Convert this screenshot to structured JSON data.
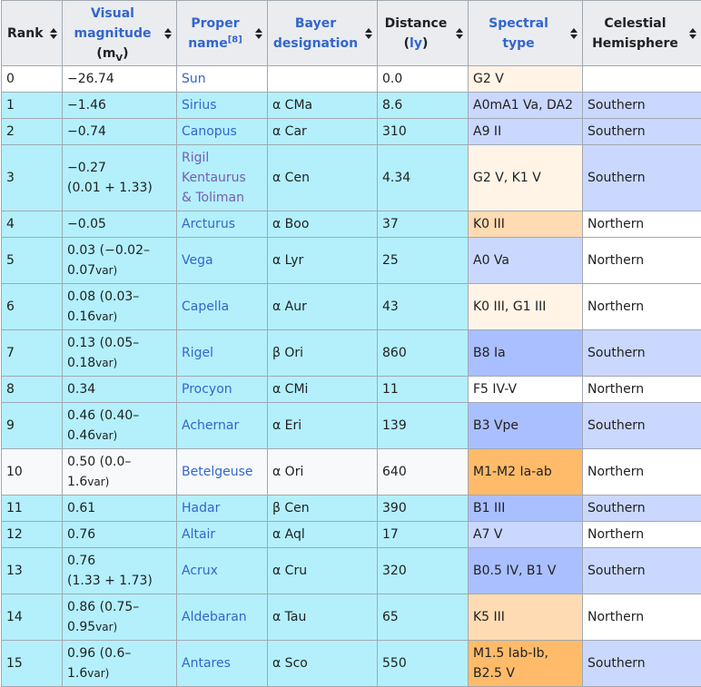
{
  "headers": {
    "rank": "Rank",
    "vmag_line1": "Visual",
    "vmag_line2": "magnitude",
    "vmag_unit_pre": "(m",
    "vmag_unit_sub": "V",
    "vmag_unit_post": ")",
    "proper_line1": "Proper",
    "proper_line2": "name",
    "proper_ref": "[8]",
    "bayer_line1": "Bayer",
    "bayer_line2": "designation",
    "distance_line1": "Distance",
    "distance_line2_pre": "(",
    "distance_unit": "ly",
    "distance_line2_post": ")",
    "spectral_line1": "Spectral",
    "spectral_line2": "type",
    "hemi_line1": "Celestial",
    "hemi_line2": "Hemisphere"
  },
  "rows": [
    {
      "rank": "0",
      "mag1": "−26.74",
      "mag2": "",
      "mag_var": "",
      "name": [
        "Sun"
      ],
      "bayer": "",
      "dist": "0.0",
      "spec": [
        "G2 V"
      ],
      "hemi": "",
      "spec_color": "#fff4e6",
      "hemi_color": "#ffffff",
      "row_color": "#ffffff",
      "name_visited": false
    },
    {
      "rank": "1",
      "mag1": "−1.46",
      "mag2": "",
      "mag_var": "",
      "name": [
        "Sirius"
      ],
      "bayer": "α CMa",
      "dist": "8.6",
      "spec": [
        "A0mA1 Va, DA2"
      ],
      "hemi": "Southern",
      "spec_color": "#cad8ff",
      "hemi_color": "#cad8ff",
      "row_color": "#b3f0fc",
      "name_visited": false
    },
    {
      "rank": "2",
      "mag1": "−0.74",
      "mag2": "",
      "mag_var": "",
      "name": [
        "Canopus"
      ],
      "bayer": "α Car",
      "dist": "310",
      "spec": [
        "A9 II"
      ],
      "hemi": "Southern",
      "spec_color": "#cad8ff",
      "hemi_color": "#cad8ff",
      "row_color": "#b3f0fc",
      "name_visited": false
    },
    {
      "rank": "3",
      "mag1": "−0.27",
      "mag2": "(0.01 + 1.33)",
      "mag_var": "",
      "name": [
        "Rigil",
        "Kentaurus",
        "& Toliman"
      ],
      "bayer": "α Cen",
      "dist": "4.34",
      "spec": [
        "G2 V, K1 V"
      ],
      "hemi": "Southern",
      "spec_color": "#fff4e6",
      "hemi_color": "#cad8ff",
      "row_color": "#b3f0fc",
      "name_visited": true
    },
    {
      "rank": "4",
      "mag1": "−0.05",
      "mag2": "",
      "mag_var": "",
      "name": [
        "Arcturus"
      ],
      "bayer": "α Boo",
      "dist": "37",
      "spec": [
        "K0 III"
      ],
      "hemi": "Northern",
      "spec_color": "#ffdbb3",
      "hemi_color": "#ffffff",
      "row_color": "#b3f0fc",
      "name_visited": false
    },
    {
      "rank": "5",
      "mag1": "0.03 (−0.02–",
      "mag2": "0.07",
      "mag_var": "var)",
      "name": [
        "Vega"
      ],
      "bayer": "α Lyr",
      "dist": "25",
      "spec": [
        "A0 Va"
      ],
      "hemi": "Northern",
      "spec_color": "#cad8ff",
      "hemi_color": "#ffffff",
      "row_color": "#b3f0fc",
      "name_visited": false
    },
    {
      "rank": "6",
      "mag1": "0.08 (0.03–",
      "mag2": "0.16",
      "mag_var": "var)",
      "name": [
        "Capella"
      ],
      "bayer": "α Aur",
      "dist": "43",
      "spec": [
        "K0 III, G1 III"
      ],
      "hemi": "Northern",
      "spec_color": "#fff4e6",
      "hemi_color": "#ffffff",
      "row_color": "#b3f0fc",
      "name_visited": false
    },
    {
      "rank": "7",
      "mag1": "0.13 (0.05–",
      "mag2": "0.18",
      "mag_var": "var)",
      "name": [
        "Rigel"
      ],
      "bayer": "β Ori",
      "dist": "860",
      "spec": [
        "B8 Ia"
      ],
      "hemi": "Southern",
      "spec_color": "#aabfff",
      "hemi_color": "#cad8ff",
      "row_color": "#b3f0fc",
      "name_visited": false
    },
    {
      "rank": "8",
      "mag1": "0.34",
      "mag2": "",
      "mag_var": "",
      "name": [
        "Procyon"
      ],
      "bayer": "α CMi",
      "dist": "11",
      "spec": [
        "F5 IV-V"
      ],
      "hemi": "Northern",
      "spec_color": "#ffffff",
      "hemi_color": "#ffffff",
      "row_color": "#b3f0fc",
      "name_visited": false
    },
    {
      "rank": "9",
      "mag1": "0.46 (0.40–",
      "mag2": "0.46",
      "mag_var": "var)",
      "name": [
        "Achernar"
      ],
      "bayer": "α Eri",
      "dist": "139",
      "spec": [
        "B3 Vpe"
      ],
      "hemi": "Southern",
      "spec_color": "#aabfff",
      "hemi_color": "#cad8ff",
      "row_color": "#b3f0fc",
      "name_visited": false
    },
    {
      "rank": "10",
      "mag1": "0.50 (0.0–",
      "mag2": "1.6",
      "mag_var": "var)",
      "name": [
        "Betelgeuse"
      ],
      "bayer": "α Ori",
      "dist": "640",
      "spec": [
        "M1-M2 Ia-ab"
      ],
      "hemi": "Northern",
      "spec_color": "#ffbb6a",
      "hemi_color": "#ffffff",
      "row_color": "#f8f9fa",
      "name_visited": false
    },
    {
      "rank": "11",
      "mag1": "0.61",
      "mag2": "",
      "mag_var": "",
      "name": [
        "Hadar"
      ],
      "bayer": "β Cen",
      "dist": "390",
      "spec": [
        "B1 III"
      ],
      "hemi": "Southern",
      "spec_color": "#aabfff",
      "hemi_color": "#cad8ff",
      "row_color": "#b3f0fc",
      "name_visited": false
    },
    {
      "rank": "12",
      "mag1": "0.76",
      "mag2": "",
      "mag_var": "",
      "name": [
        "Altair"
      ],
      "bayer": "α Aql",
      "dist": "17",
      "spec": [
        "A7 V"
      ],
      "hemi": "Northern",
      "spec_color": "#cad8ff",
      "hemi_color": "#ffffff",
      "row_color": "#b3f0fc",
      "name_visited": false
    },
    {
      "rank": "13",
      "mag1": "0.76",
      "mag2": "(1.33 + 1.73)",
      "mag_var": "",
      "name": [
        "Acrux"
      ],
      "bayer": "α Cru",
      "dist": "320",
      "spec": [
        "B0.5 IV, B1 V"
      ],
      "hemi": "Southern",
      "spec_color": "#aabfff",
      "hemi_color": "#cad8ff",
      "row_color": "#b3f0fc",
      "name_visited": false
    },
    {
      "rank": "14",
      "mag1": "0.86 (0.75–",
      "mag2": "0.95",
      "mag_var": "var)",
      "name": [
        "Aldebaran"
      ],
      "bayer": "α Tau",
      "dist": "65",
      "spec": [
        "K5 III"
      ],
      "hemi": "Northern",
      "spec_color": "#ffdbb3",
      "hemi_color": "#ffffff",
      "row_color": "#b3f0fc",
      "name_visited": false
    },
    {
      "rank": "15",
      "mag1": "0.96 (0.6–",
      "mag2": "1.6",
      "mag_var": "var)",
      "name": [
        "Antares"
      ],
      "bayer": "α Sco",
      "dist": "550",
      "spec": [
        "M1.5 Iab-Ib,",
        "B2.5 V"
      ],
      "hemi": "Southern",
      "spec_color": "#ffbb6a",
      "hemi_color": "#cad8ff",
      "row_color": "#b3f0fc",
      "name_visited": false
    }
  ]
}
